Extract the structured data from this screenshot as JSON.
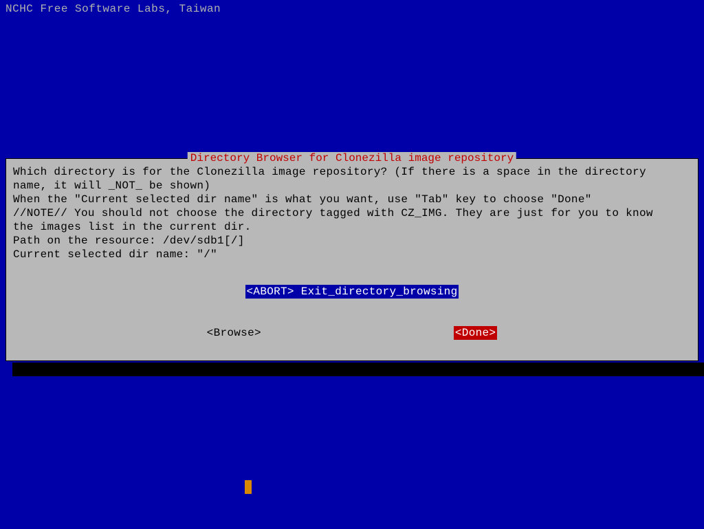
{
  "header": {
    "title": "NCHC Free Software Labs, Taiwan"
  },
  "dialog": {
    "title": " Directory Browser for Clonezilla image repository ",
    "body_line1": "Which directory is for the Clonezilla image repository? (If there is a space in the directory",
    "body_line2": "name, it will _NOT_ be shown)",
    "body_line3": "When the \"Current selected dir name\" is what you want, use \"Tab\" key to choose \"Done\"",
    "body_line4": "//NOTE// You should not choose the directory tagged with CZ_IMG. They are just for you to know",
    "body_line5": "the images list in the current dir.",
    "body_line6": "Path on the resource: /dev/sdb1[/]",
    "body_line7": "Current selected dir name: \"/\"",
    "menu": {
      "item_key": "<ABORT>",
      "item_label": " Exit_directory_browsing"
    },
    "buttons": {
      "browse": "<Browse>",
      "done": "<Done>"
    }
  }
}
